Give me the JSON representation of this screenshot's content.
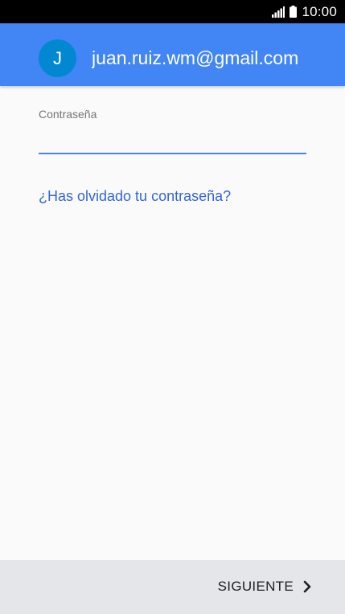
{
  "status_bar": {
    "time": "10:00",
    "signal_icon": "signal-icon",
    "battery_icon": "battery-icon"
  },
  "header": {
    "avatar_initial": "J",
    "account_email": "juan.ruiz.wm@gmail.com",
    "background_color": "#4285f4",
    "avatar_color": "#0288d1"
  },
  "form": {
    "password_label": "Contraseña",
    "password_value": "",
    "forgot_password_link": "¿Has olvidado tu contraseña?"
  },
  "footer": {
    "next_label": "SIGUIENTE",
    "next_icon": "chevron-right-icon"
  }
}
